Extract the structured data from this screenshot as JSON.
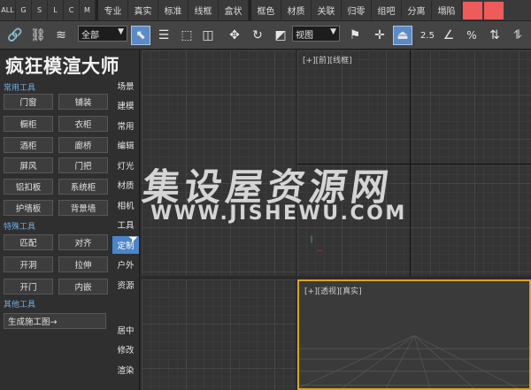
{
  "menubar": {
    "quick": [
      "ALL",
      "G",
      "S",
      "L",
      "C",
      "M"
    ],
    "items": [
      "专业",
      "真实",
      "标准",
      "线框",
      "盒状"
    ],
    "items2": [
      "框色",
      "材质",
      "关联",
      "归零",
      "组吧",
      "分离",
      "塌陷"
    ],
    "accent_colors": [
      "#ee5b5b",
      "#ee5b5b"
    ]
  },
  "toolbar": {
    "selection_filter": "全部",
    "coord_system": "视图",
    "snap_percent_label": "2.5",
    "percent_label": "%",
    "icons": [
      "link-icon",
      "unlink-icon",
      "bind-space-warp-icon",
      "select-object-icon",
      "select-by-name-icon",
      "rect-selection-icon",
      "window-crossing-icon",
      "move-icon",
      "rotate-icon",
      "scale-icon",
      "named-selection-icon",
      "pivot-icon",
      "snap-toggle-icon",
      "angle-snap-icon",
      "percent-snap-icon",
      "spinner-snap-icon",
      "mirror-icon"
    ]
  },
  "panel": {
    "title": "疯狂模渲大师",
    "sections": {
      "common": "常用工具",
      "special": "特殊工具",
      "other": "其他工具"
    },
    "common_buttons": [
      "门窗",
      "铺装",
      "橱柜",
      "衣柜",
      "酒柜",
      "廊桥",
      "屏风",
      "门把",
      "铝扣板",
      "系统柜",
      "护墙板",
      "背景墙"
    ],
    "special_buttons": [
      "匹配",
      "对齐",
      "开洞",
      "拉伸",
      "开门",
      "内嵌"
    ],
    "other_button": "生成施工图→",
    "tabs": [
      "场景",
      "建模",
      "常用",
      "编辑",
      "灯光",
      "材质",
      "相机",
      "工具",
      "定制",
      "户外",
      "资源"
    ],
    "active_tab": "定制",
    "bottom_tabs": [
      "居中",
      "修改",
      "渲染"
    ]
  },
  "viewports": {
    "top_right_label": "[+][前][线框]",
    "bottom_right_label": "[+][透视][真实]",
    "active_border_color": "#d9a520"
  },
  "watermark": {
    "cn": "集设屋资源网",
    "url": "WWW.JISHEWU.COM"
  }
}
